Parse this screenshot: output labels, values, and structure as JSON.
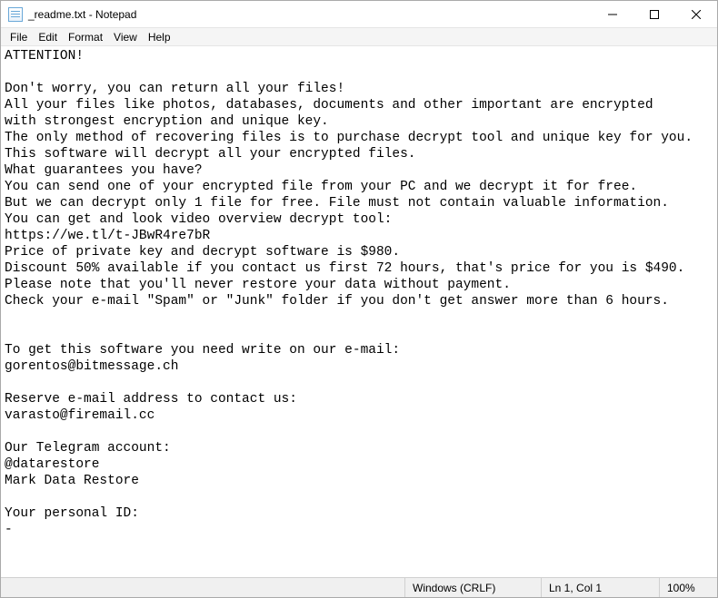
{
  "window": {
    "title": "_readme.txt - Notepad"
  },
  "menubar": {
    "file": "File",
    "edit": "Edit",
    "format": "Format",
    "view": "View",
    "help": "Help"
  },
  "content": "ATTENTION!\n\nDon't worry, you can return all your files!\nAll your files like photos, databases, documents and other important are encrypted\nwith strongest encryption and unique key.\nThe only method of recovering files is to purchase decrypt tool and unique key for you.\nThis software will decrypt all your encrypted files.\nWhat guarantees you have?\nYou can send one of your encrypted file from your PC and we decrypt it for free.\nBut we can decrypt only 1 file for free. File must not contain valuable information.\nYou can get and look video overview decrypt tool:\nhttps://we.tl/t-JBwR4re7bR\nPrice of private key and decrypt software is $980.\nDiscount 50% available if you contact us first 72 hours, that's price for you is $490.\nPlease note that you'll never restore your data without payment.\nCheck your e-mail \"Spam\" or \"Junk\" folder if you don't get answer more than 6 hours.\n\n\nTo get this software you need write on our e-mail:\ngorentos@bitmessage.ch\n\nReserve e-mail address to contact us:\nvarasto@firemail.cc\n\nOur Telegram account:\n@datarestore\nMark Data Restore\n\nYour personal ID:\n-",
  "statusbar": {
    "encoding": "Windows (CRLF)",
    "position": "Ln 1, Col 1",
    "zoom": "100%"
  }
}
